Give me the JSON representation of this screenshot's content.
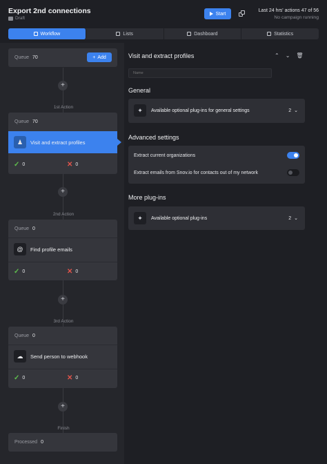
{
  "header": {
    "title": "Export 2nd connections",
    "status": "Draft",
    "start_label": "Start",
    "actions_info": "Last 24 hrs' actions 47 of 56",
    "campaign_status": "No campaign running"
  },
  "tabs": [
    {
      "label": "Workflow",
      "icon": "workflow-icon"
    },
    {
      "label": "Lists",
      "icon": "list-icon"
    },
    {
      "label": "Dashboard",
      "icon": "dashboard-icon"
    },
    {
      "label": "Statistics",
      "icon": "statistics-icon"
    }
  ],
  "workflow": {
    "top_queue": {
      "label": "Queue",
      "count": "70",
      "add_label": "Add"
    },
    "steps": [
      {
        "step_label": "1st Action",
        "queue_label": "Queue",
        "queue_count": "70",
        "action": "Visit and extract profiles",
        "icon": "profile-icon",
        "success": "0",
        "fail": "0"
      },
      {
        "step_label": "2nd Action",
        "queue_label": "Queue",
        "queue_count": "0",
        "action": "Find profile emails",
        "icon": "at-icon",
        "success": "0",
        "fail": "0"
      },
      {
        "step_label": "3rd Action",
        "queue_label": "Queue",
        "queue_count": "0",
        "action": "Send person to webhook",
        "icon": "cloud-icon",
        "success": "0",
        "fail": "0"
      }
    ],
    "finish": {
      "step_label": "Finish",
      "label": "Processed",
      "count": "0"
    }
  },
  "panel": {
    "title": "Visit and extract profiles",
    "name_placeholder": "Name",
    "general_heading": "General",
    "general_plugins": {
      "label": "Available optional plug-ins for general settings",
      "count": "2"
    },
    "advanced_heading": "Advanced settings",
    "settings": [
      {
        "label": "Extract current organizations",
        "enabled": true
      },
      {
        "label": "Extract emails from Snov.io for contacts out of my network",
        "enabled": false
      }
    ],
    "more_heading": "More plug-ins",
    "more_plugins": {
      "label": "Available optional plug-ins",
      "count": "2"
    }
  },
  "colors": {
    "accent": "#3c82ee",
    "success": "#5fbf4d",
    "error": "#e0544b"
  }
}
